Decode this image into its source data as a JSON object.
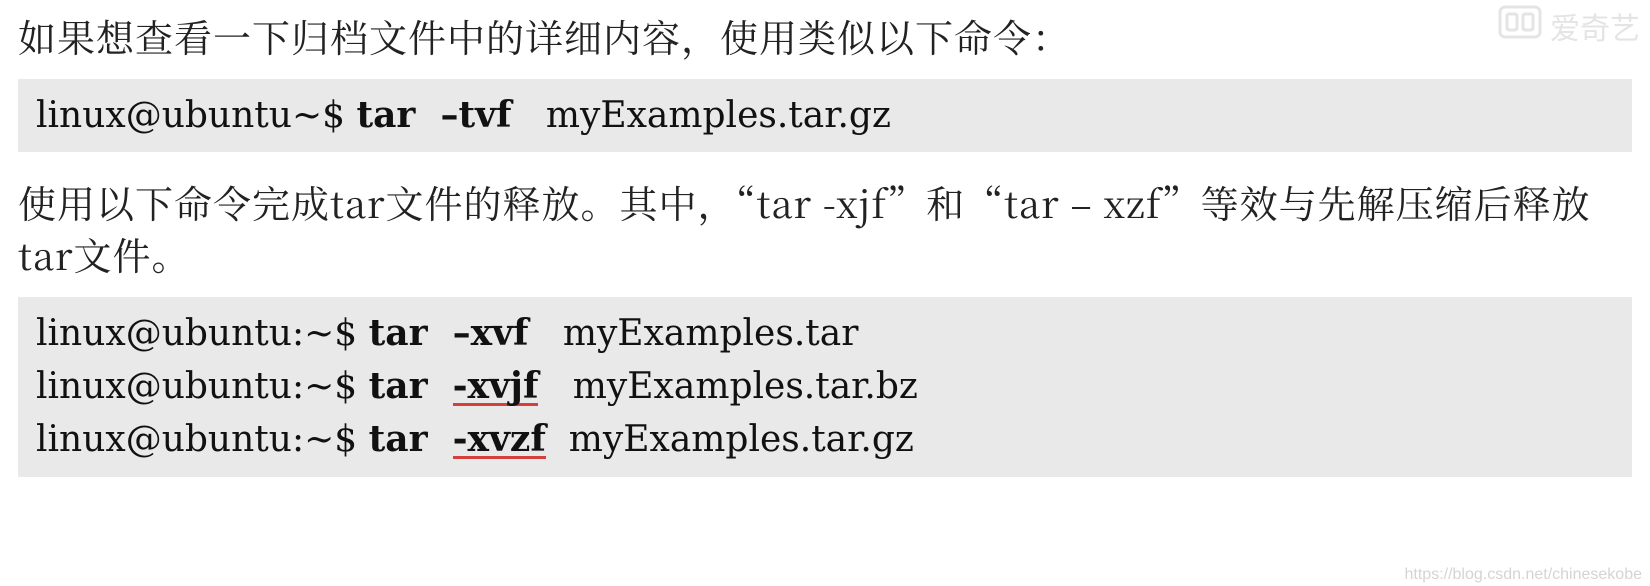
{
  "intro1": "如果想查看一下归档文件中的详细内容，使用类似以下命令：",
  "block1": {
    "prompt": "linux@ubuntu~$ ",
    "cmd": "tar",
    "flag": "–tvf",
    "arg": "myExamples.tar.gz"
  },
  "intro2": "使用以下命令完成tar文件的释放。其中，“tar -xjf”和“tar  – xzf”等效与先解压缩后释放tar文件。",
  "block2": {
    "lines": [
      {
        "prompt": "linux@ubuntu:~$ ",
        "cmd": "tar",
        "flag": "–xvf",
        "arg": "myExamples.tar",
        "ul": false
      },
      {
        "prompt": "linux@ubuntu:~$ ",
        "cmd": "tar",
        "flag": "-xvjf",
        "arg": "myExamples.tar.bz",
        "ul": true
      },
      {
        "prompt": "linux@ubuntu:~$ ",
        "cmd": "tar",
        "flag": "-xvzf",
        "arg": "myExamples.tar.gz",
        "ul": true
      }
    ]
  },
  "watermark_top": "爱奇艺",
  "watermark_bottom": "https://blog.csdn.net/chinesekobe"
}
